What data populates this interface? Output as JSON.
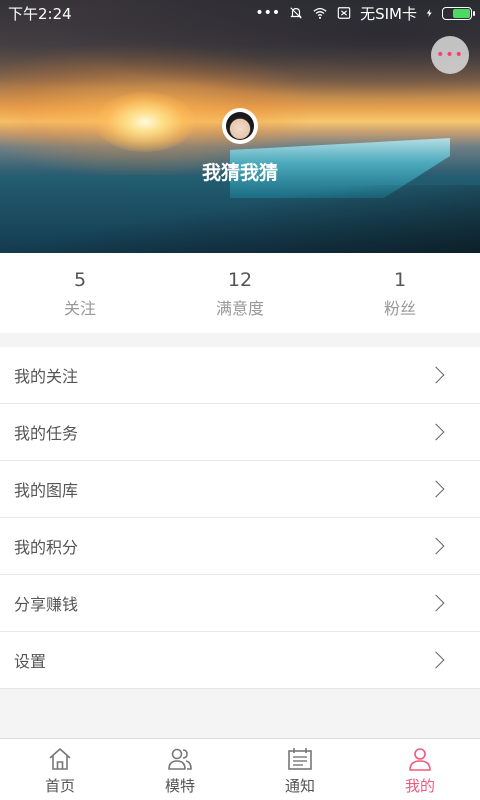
{
  "status_bar": {
    "time": "下午2:24",
    "carrier": "无SIM卡",
    "battery_color": "#4cd964"
  },
  "profile": {
    "username": "我猜我猜",
    "more_icon": "more-dots-icon",
    "avatar_icon": "avatar"
  },
  "stats": [
    {
      "value": "5",
      "label": "关注"
    },
    {
      "value": "12",
      "label": "满意度"
    },
    {
      "value": "1",
      "label": "粉丝"
    }
  ],
  "menu": [
    {
      "label": "我的关注"
    },
    {
      "label": "我的任务"
    },
    {
      "label": "我的图库"
    },
    {
      "label": "我的积分"
    },
    {
      "label": "分享赚钱"
    },
    {
      "label": "设置"
    }
  ],
  "bottom_nav": [
    {
      "label": "首页",
      "icon": "home-icon"
    },
    {
      "label": "模特",
      "icon": "users-icon"
    },
    {
      "label": "通知",
      "icon": "notice-icon"
    },
    {
      "label": "我的",
      "icon": "user-icon",
      "active": true
    }
  ],
  "colors": {
    "accent": "#f05a7e",
    "text_primary": "#555555",
    "text_secondary": "#999999"
  }
}
